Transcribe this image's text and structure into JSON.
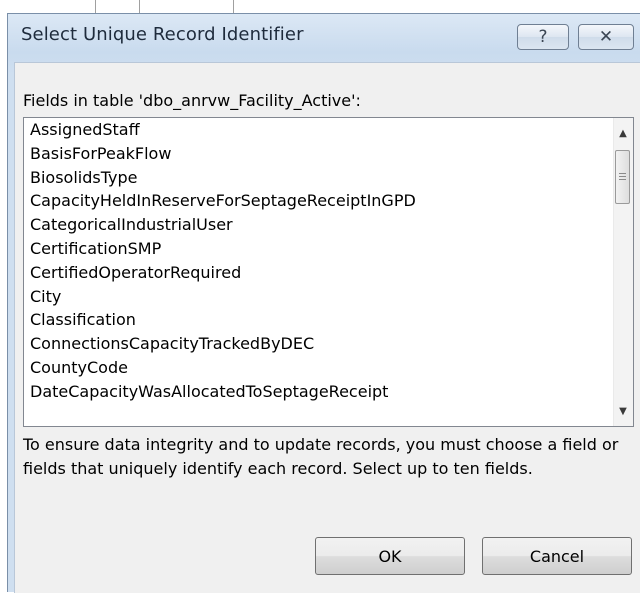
{
  "dialog": {
    "title": "Select Unique Record Identifier",
    "help_label": "?",
    "close_label": "✕"
  },
  "fields_label": "Fields in table 'dbo_anrvw_Facility_Active':",
  "fields": [
    "AssignedStaff",
    "BasisForPeakFlow",
    "BiosolidsType",
    "CapacityHeldInReserveForSeptageReceiptInGPD",
    "CategoricalIndustrialUser",
    "CertificationSMP",
    "CertifiedOperatorRequired",
    "City",
    "Classification",
    "ConnectionsCapacityTrackedByDEC",
    "CountyCode",
    "DateCapacityWasAllocatedToSeptageReceipt"
  ],
  "info_text": "To ensure data integrity and to update records, you must choose a field or fields that uniquely identify each record. Select up to ten fields.",
  "buttons": {
    "ok": "OK",
    "cancel": "Cancel"
  },
  "scrollbar": {
    "up_icon": "▲",
    "down_icon": "▼"
  }
}
